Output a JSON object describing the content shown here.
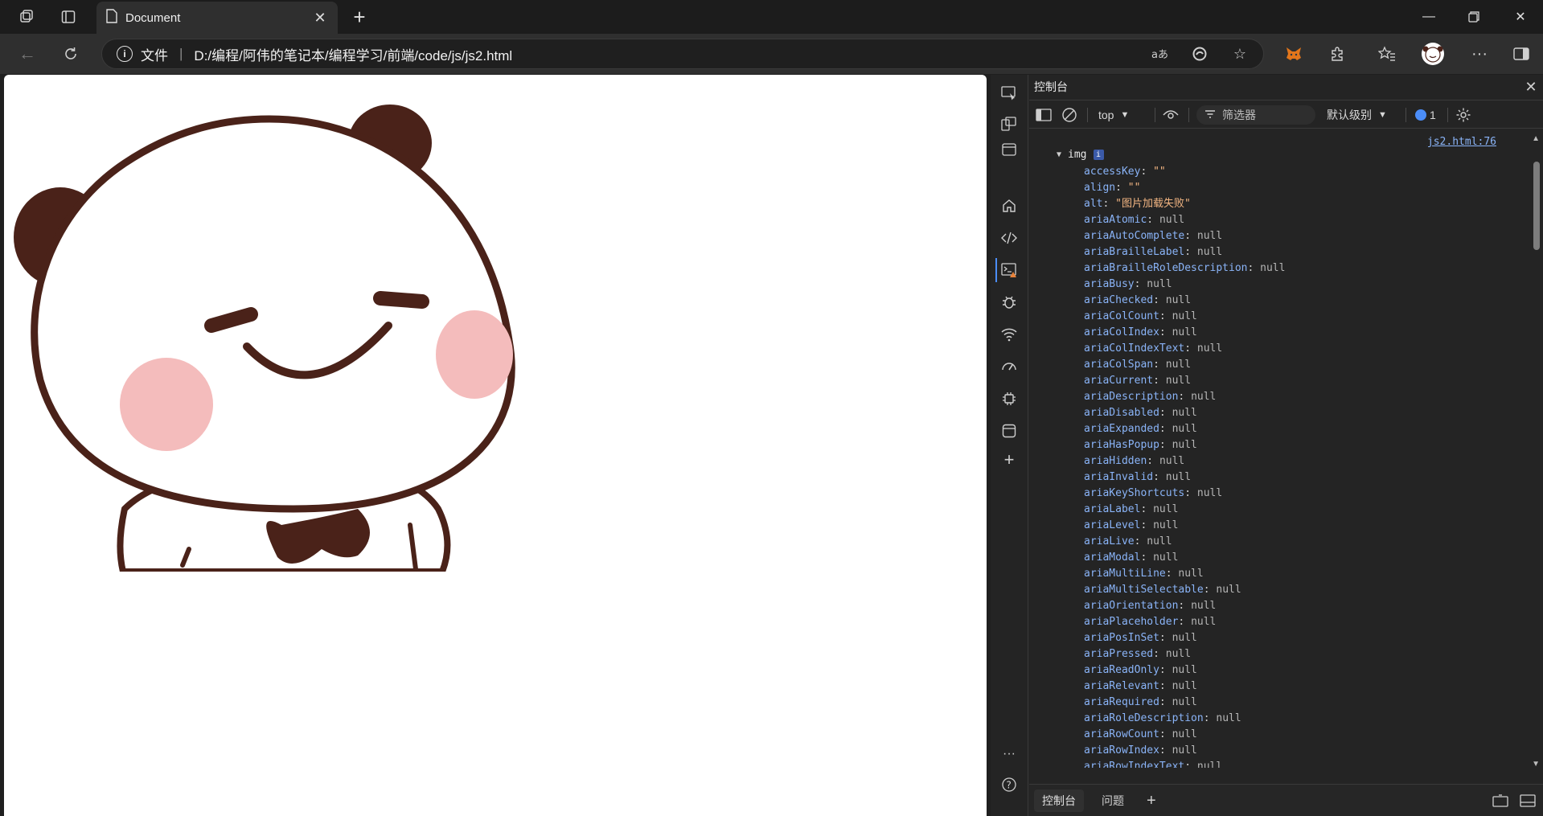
{
  "browser": {
    "tab_title": "Document",
    "address_scheme": "文件",
    "address_url": "D:/编程/阿伟的笔记本/编程学习/前端/code/js/js2.html",
    "window_controls": [
      "minimize",
      "restore",
      "close"
    ]
  },
  "devtools": {
    "panel_title": "控制台",
    "context": "top",
    "filter_placeholder": "筛选器",
    "log_level": "默认级别",
    "message_count": "1",
    "source_link": "js2.html:76",
    "object_label": "img",
    "properties": [
      {
        "key": "accessKey",
        "value": "\"\"",
        "kind": "str"
      },
      {
        "key": "align",
        "value": "\"\"",
        "kind": "str"
      },
      {
        "key": "alt",
        "value": "\"图片加载失败\"",
        "kind": "str"
      },
      {
        "key": "ariaAtomic",
        "value": "null",
        "kind": "null"
      },
      {
        "key": "ariaAutoComplete",
        "value": "null",
        "kind": "null"
      },
      {
        "key": "ariaBrailleLabel",
        "value": "null",
        "kind": "null"
      },
      {
        "key": "ariaBrailleRoleDescription",
        "value": "null",
        "kind": "null"
      },
      {
        "key": "ariaBusy",
        "value": "null",
        "kind": "null"
      },
      {
        "key": "ariaChecked",
        "value": "null",
        "kind": "null"
      },
      {
        "key": "ariaColCount",
        "value": "null",
        "kind": "null"
      },
      {
        "key": "ariaColIndex",
        "value": "null",
        "kind": "null"
      },
      {
        "key": "ariaColIndexText",
        "value": "null",
        "kind": "null"
      },
      {
        "key": "ariaColSpan",
        "value": "null",
        "kind": "null"
      },
      {
        "key": "ariaCurrent",
        "value": "null",
        "kind": "null"
      },
      {
        "key": "ariaDescription",
        "value": "null",
        "kind": "null"
      },
      {
        "key": "ariaDisabled",
        "value": "null",
        "kind": "null"
      },
      {
        "key": "ariaExpanded",
        "value": "null",
        "kind": "null"
      },
      {
        "key": "ariaHasPopup",
        "value": "null",
        "kind": "null"
      },
      {
        "key": "ariaHidden",
        "value": "null",
        "kind": "null"
      },
      {
        "key": "ariaInvalid",
        "value": "null",
        "kind": "null"
      },
      {
        "key": "ariaKeyShortcuts",
        "value": "null",
        "kind": "null"
      },
      {
        "key": "ariaLabel",
        "value": "null",
        "kind": "null"
      },
      {
        "key": "ariaLevel",
        "value": "null",
        "kind": "null"
      },
      {
        "key": "ariaLive",
        "value": "null",
        "kind": "null"
      },
      {
        "key": "ariaModal",
        "value": "null",
        "kind": "null"
      },
      {
        "key": "ariaMultiLine",
        "value": "null",
        "kind": "null"
      },
      {
        "key": "ariaMultiSelectable",
        "value": "null",
        "kind": "null"
      },
      {
        "key": "ariaOrientation",
        "value": "null",
        "kind": "null"
      },
      {
        "key": "ariaPlaceholder",
        "value": "null",
        "kind": "null"
      },
      {
        "key": "ariaPosInSet",
        "value": "null",
        "kind": "null"
      },
      {
        "key": "ariaPressed",
        "value": "null",
        "kind": "null"
      },
      {
        "key": "ariaReadOnly",
        "value": "null",
        "kind": "null"
      },
      {
        "key": "ariaRelevant",
        "value": "null",
        "kind": "null"
      },
      {
        "key": "ariaRequired",
        "value": "null",
        "kind": "null"
      },
      {
        "key": "ariaRoleDescription",
        "value": "null",
        "kind": "null"
      },
      {
        "key": "ariaRowCount",
        "value": "null",
        "kind": "null"
      },
      {
        "key": "ariaRowIndex",
        "value": "null",
        "kind": "null"
      },
      {
        "key": "ariaRowIndexText",
        "value": "null",
        "kind": "null"
      }
    ],
    "drawer_tabs": {
      "console": "控制台",
      "issues": "问题"
    }
  },
  "colors": {
    "accent_link": "#8ab4f8",
    "string_value": "#f2b582",
    "panda_outline": "#4a2219",
    "panda_blush": "#f4bcbc"
  }
}
